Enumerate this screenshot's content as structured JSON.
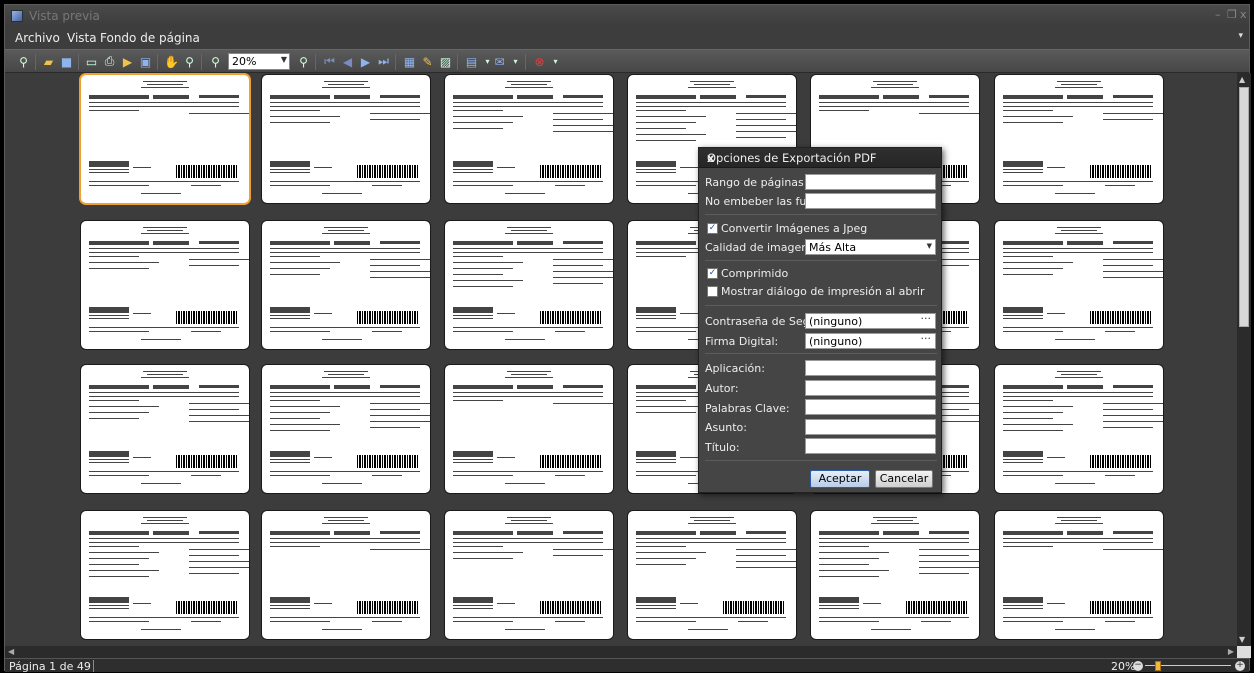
{
  "window": {
    "title": "Vista previa"
  },
  "menu": {
    "items": [
      "Archivo",
      "Vista",
      "Fondo de página"
    ]
  },
  "toolbar": {
    "zoom_value": "20%"
  },
  "status": {
    "page_info": "Página 1 de 49",
    "zoom_label": "20%",
    "zoom_fraction": 0.2
  },
  "dialog": {
    "title": "Opciones de Exportación PDF",
    "close": "x",
    "page_range_label": "Rango de páginas:",
    "page_range_value": "",
    "no_embed_fonts_label": "No embeber las fuentes:",
    "no_embed_fonts_value": "",
    "convert_jpeg_label": "Convertir Imágenes a Jpeg",
    "convert_jpeg_checked": true,
    "image_quality_label": "Calidad de imagen:",
    "image_quality_value": "Más Alta",
    "compressed_label": "Comprimido",
    "compressed_checked": true,
    "show_print_label": "Mostrar diálogo de impresión al abrir",
    "show_print_checked": false,
    "security_password_label": "Contraseña de Seguridad:",
    "security_password_value": "(ninguno)",
    "digital_signature_label": "Firma Digital:",
    "digital_signature_value": "(ninguno)",
    "application_label": "Aplicación:",
    "author_label": "Autor:",
    "keywords_label": "Palabras Clave:",
    "subject_label": "Asunto:",
    "title_label": "Título:",
    "ok_label": "Aceptar",
    "cancel_label": "Cancelar"
  }
}
